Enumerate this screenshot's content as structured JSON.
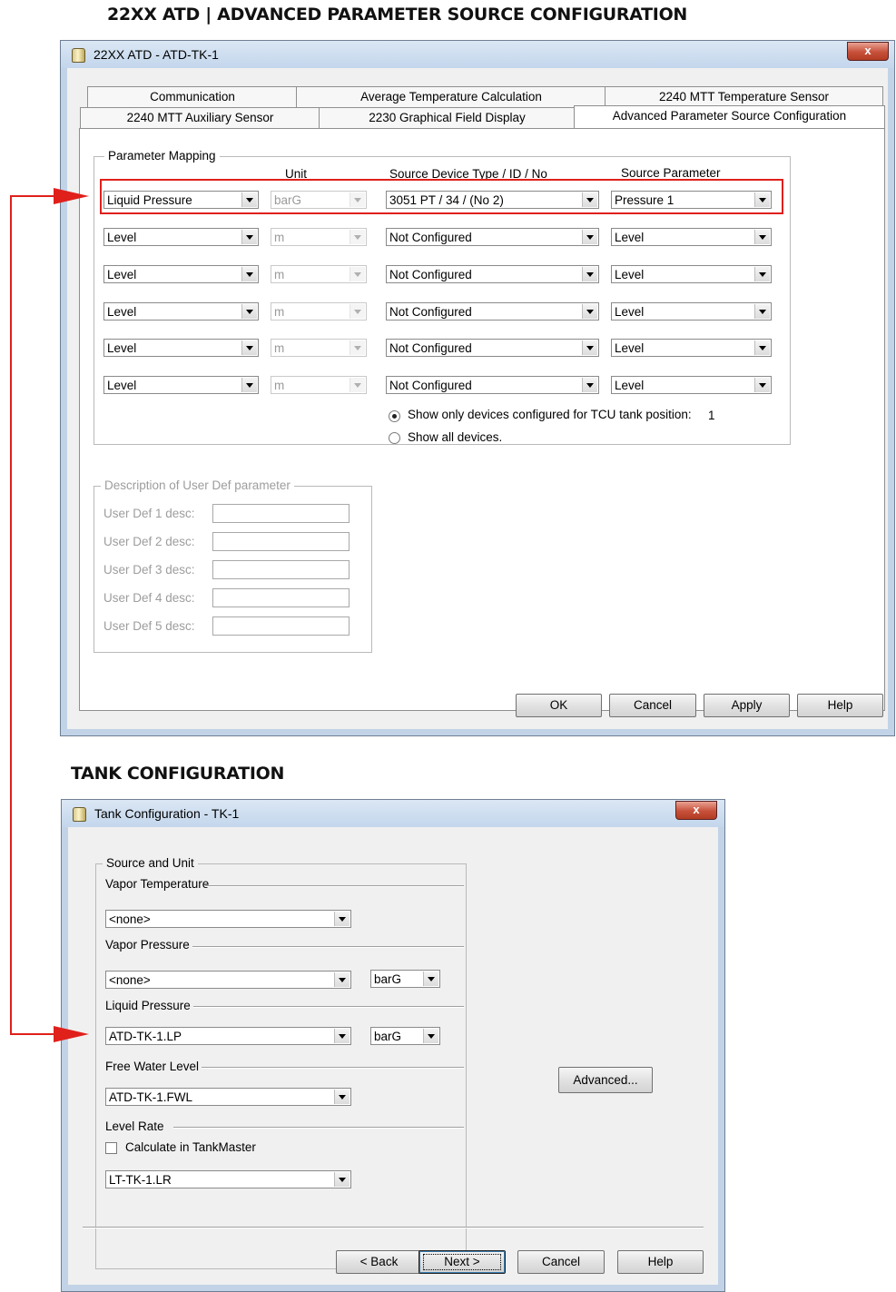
{
  "heading_top": "22XX ATD | ADVANCED PARAMETER SOURCE CONFIGURATION",
  "heading_bottom": "TANK CONFIGURATION",
  "colors": {
    "highlight": "#e0201b",
    "arrow": "#e0201b"
  },
  "dialog1": {
    "title": "22XX ATD  - ATD-TK-1",
    "close_icon": "close-icon",
    "tabs_row1": [
      "Communication",
      "Average Temperature Calculation",
      "2240 MTT Temperature Sensor"
    ],
    "tabs_row2": [
      "2240 MTT Auxiliary Sensor",
      "2230 Graphical Field Display",
      "Advanced Parameter Source Configuration"
    ],
    "parameter_mapping": {
      "group_label": "Parameter Mapping",
      "col_unit": "Unit",
      "col_source_device": "Source Device Type / ID / No",
      "col_source_param": "Source Parameter",
      "rows": [
        {
          "parameter": "Liquid Pressure",
          "unit": "barG",
          "device": "3051 PT / 34 / (No 2)",
          "source_param": "Pressure 1"
        },
        {
          "parameter": "Level",
          "unit": "m",
          "device": "Not Configured",
          "source_param": "Level"
        },
        {
          "parameter": "Level",
          "unit": "m",
          "device": "Not Configured",
          "source_param": "Level"
        },
        {
          "parameter": "Level",
          "unit": "m",
          "device": "Not Configured",
          "source_param": "Level"
        },
        {
          "parameter": "Level",
          "unit": "m",
          "device": "Not Configured",
          "source_param": "Level"
        },
        {
          "parameter": "Level",
          "unit": "m",
          "device": "Not Configured",
          "source_param": "Level"
        }
      ],
      "radio_show_configured": "Show only devices configured for TCU tank position:",
      "tank_position": "1",
      "radio_show_all": "Show all devices."
    },
    "user_def": {
      "group_label": "Description of User Def parameter",
      "labels": [
        "User Def 1 desc:",
        "User Def 2 desc:",
        "User Def 3 desc:",
        "User Def 4 desc:",
        "User Def 5 desc:"
      ]
    },
    "buttons": {
      "ok": "OK",
      "cancel": "Cancel",
      "apply": "Apply",
      "help": "Help"
    }
  },
  "dialog2": {
    "title": "Tank Configuration - TK-1",
    "close_icon": "close-icon",
    "source_unit_label": "Source and Unit",
    "vapor_temp_label": "Vapor Temperature",
    "vapor_temp_value": "<none>",
    "vapor_pressure_label": "Vapor Pressure",
    "vapor_pressure_value": "<none>",
    "vapor_pressure_unit": "barG",
    "liquid_pressure_label": "Liquid Pressure",
    "liquid_pressure_value": "ATD-TK-1.LP",
    "liquid_pressure_unit": "barG",
    "fwl_label": "Free Water Level",
    "fwl_value": "ATD-TK-1.FWL",
    "level_rate_label": "Level Rate",
    "calc_checkbox_label": "Calculate in TankMaster",
    "level_rate_value": "LT-TK-1.LR",
    "advanced_button": "Advanced...",
    "buttons": {
      "back": "< Back",
      "next": "Next >",
      "cancel": "Cancel",
      "help": "Help"
    }
  }
}
